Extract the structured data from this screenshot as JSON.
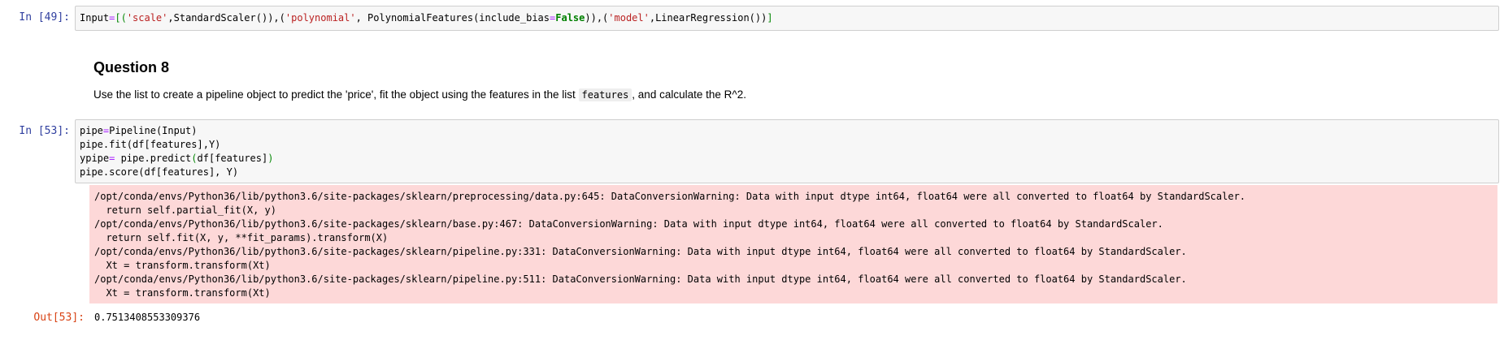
{
  "cells": {
    "cell49": {
      "prompt": "In [49]:",
      "line1": {
        "p1": "Input",
        "p2": "=",
        "p3": "[(",
        "p4": "'scale'",
        "p5": ",StandardScaler()),(",
        "p6": "'polynomial'",
        "p7": ", PolynomialFeatures(include_bias",
        "p8": "=",
        "p9": "False",
        "p10": ")),(",
        "p11": "'model'",
        "p12": ",LinearRegression())",
        "p13": "]"
      }
    },
    "markdown": {
      "heading": "Question 8",
      "text_before": "Use the list to create a pipeline object to predict the 'price', fit the object using the features in the list ",
      "inline_code": "features",
      "text_after": ", and calculate the R^2."
    },
    "cell53": {
      "prompt": "In [53]:",
      "line1": {
        "a": "pipe",
        "b": "=",
        "c": "Pipeline(Input)"
      },
      "line2": "pipe.fit(df[features],Y)",
      "line3": {
        "a": "ypipe",
        "b": "=",
        "c": " pipe.predict",
        "d": "(",
        "e": "df[features]",
        "f": ")"
      },
      "line4": "pipe.score(df[features], Y)",
      "stderr": [
        "/opt/conda/envs/Python36/lib/python3.6/site-packages/sklearn/preprocessing/data.py:645: DataConversionWarning: Data with input dtype int64, float64 were all converted to float64 by StandardScaler.",
        "  return self.partial_fit(X, y)",
        "/opt/conda/envs/Python36/lib/python3.6/site-packages/sklearn/base.py:467: DataConversionWarning: Data with input dtype int64, float64 were all converted to float64 by StandardScaler.",
        "  return self.fit(X, y, **fit_params).transform(X)",
        "/opt/conda/envs/Python36/lib/python3.6/site-packages/sklearn/pipeline.py:331: DataConversionWarning: Data with input dtype int64, float64 were all converted to float64 by StandardScaler.",
        "  Xt = transform.transform(Xt)",
        "/opt/conda/envs/Python36/lib/python3.6/site-packages/sklearn/pipeline.py:511: DataConversionWarning: Data with input dtype int64, float64 were all converted to float64 by StandardScaler.",
        "  Xt = transform.transform(Xt)"
      ],
      "out_prompt": "Out[53]:",
      "output": "0.7513408553309376"
    }
  },
  "colors": {
    "in_prompt": "#303f9f",
    "out_prompt": "#d84315",
    "stderr_bg": "#fdd8d8",
    "code_bg": "#f7f7f7",
    "string": "#ba2121",
    "operator": "#aa22ff",
    "keyword": "#008000"
  }
}
